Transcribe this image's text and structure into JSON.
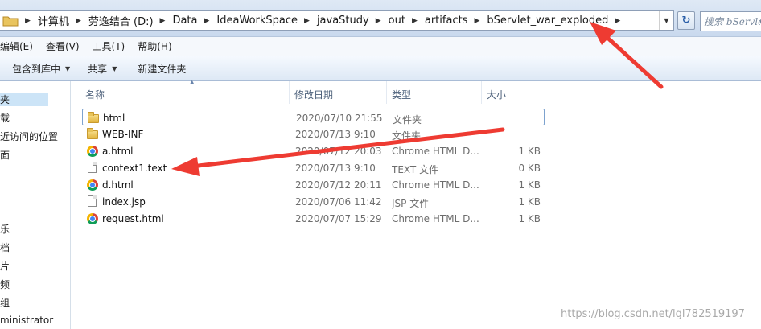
{
  "address_bar": {
    "breadcrumbs": [
      "计算机",
      "劳逸结合 (D:)",
      "Data",
      "IdeaWorkSpace",
      "javaStudy",
      "out",
      "artifacts",
      "bServlet_war_exploded"
    ]
  },
  "search": {
    "placeholder": "搜索 bServlet"
  },
  "menu": [
    "编辑(E)",
    "查看(V)",
    "工具(T)",
    "帮助(H)"
  ],
  "toolbar": {
    "include_library": "包含到库中",
    "share": "共享",
    "new_folder": "新建文件夹"
  },
  "nav": {
    "items": [
      "夹",
      "载",
      "近访问的位置",
      "面",
      "乐",
      "档",
      "片",
      "频",
      "组",
      "ministrator"
    ]
  },
  "columns": {
    "name": "名称",
    "date": "修改日期",
    "type": "类型",
    "size": "大小"
  },
  "files": [
    {
      "name": "html",
      "date": "2020/07/10 21:55",
      "type": "文件夹",
      "size": "",
      "icon": "folder-icon"
    },
    {
      "name": "WEB-INF",
      "date": "2020/07/13 9:10",
      "type": "文件夹",
      "size": "",
      "icon": "folder-icon"
    },
    {
      "name": "a.html",
      "date": "2020/07/12 20:03",
      "type": "Chrome HTML D...",
      "size": "1 KB",
      "icon": "chrome-icon"
    },
    {
      "name": "context1.text",
      "date": "2020/07/13 9:10",
      "type": "TEXT 文件",
      "size": "0 KB",
      "icon": "document-icon"
    },
    {
      "name": "d.html",
      "date": "2020/07/12 20:11",
      "type": "Chrome HTML D...",
      "size": "1 KB",
      "icon": "chrome-icon"
    },
    {
      "name": "index.jsp",
      "date": "2020/07/06 11:42",
      "type": "JSP 文件",
      "size": "1 KB",
      "icon": "document-icon"
    },
    {
      "name": "request.html",
      "date": "2020/07/07 15:29",
      "type": "Chrome HTML D...",
      "size": "1 KB",
      "icon": "chrome-icon"
    }
  ],
  "watermark": "https://blog.csdn.net/lgl782519197",
  "colors": {
    "arrow": "#ee3b32",
    "selection": "#cce4f7",
    "header_text": "#4c607a"
  }
}
